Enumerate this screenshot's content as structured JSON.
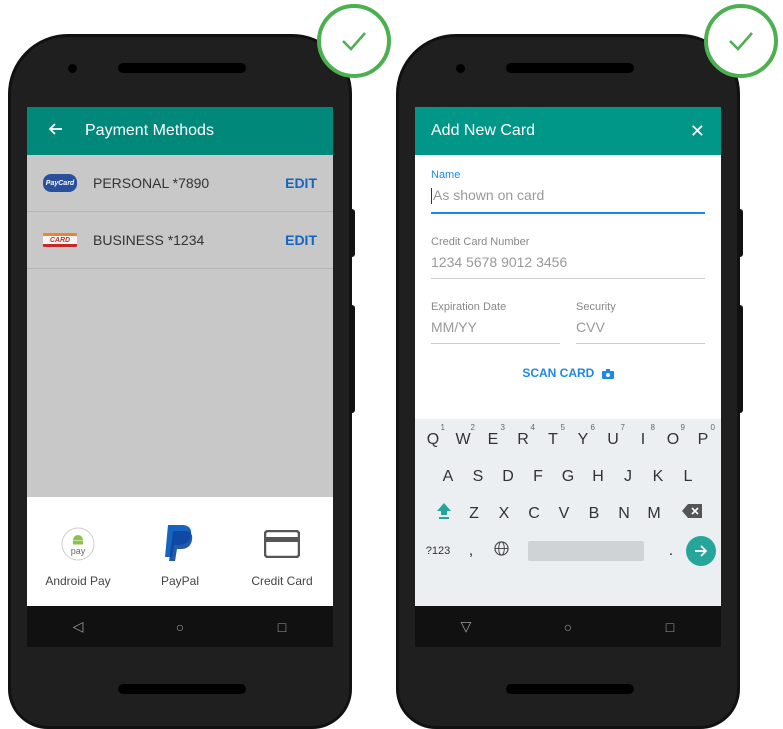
{
  "left_screen": {
    "app_bar": {
      "back_icon": "arrow-left-icon",
      "title": "Payment Methods"
    },
    "cards": [
      {
        "logo": "PayCard",
        "name": "PERSONAL *7890",
        "action": "EDIT"
      },
      {
        "logo": "CARD",
        "name": "BUSINESS *1234",
        "action": "EDIT"
      }
    ],
    "payment_options": [
      {
        "icon": "android-pay-icon",
        "icon_text": "pay",
        "label": "Android Pay"
      },
      {
        "icon": "paypal-icon",
        "label": "PayPal"
      },
      {
        "icon": "credit-card-icon",
        "label": "Credit Card"
      }
    ],
    "nav": {
      "back": "◁",
      "home": "○",
      "recents": "□"
    }
  },
  "right_screen": {
    "app_bar": {
      "title": "Add New Card",
      "close": "✕"
    },
    "form": {
      "name_label": "Name",
      "name_placeholder": "As shown on card",
      "number_label": "Credit Card Number",
      "number_placeholder": "1234 5678 9012 3456",
      "expiry_label": "Expiration Date",
      "expiry_placeholder": "MM/YY",
      "security_label": "Security",
      "security_placeholder": "CVV",
      "scan_label": "SCAN CARD"
    },
    "keyboard": {
      "row1": [
        "Q",
        "W",
        "E",
        "R",
        "T",
        "Y",
        "U",
        "I",
        "O",
        "P"
      ],
      "row1_hints": [
        "1",
        "2",
        "3",
        "4",
        "5",
        "6",
        "7",
        "8",
        "9",
        "0"
      ],
      "row2": [
        "A",
        "S",
        "D",
        "F",
        "G",
        "H",
        "J",
        "K",
        "L"
      ],
      "row3": [
        "Z",
        "X",
        "C",
        "V",
        "B",
        "N",
        "M"
      ],
      "symbols_key": "?123",
      "comma": ",",
      "period": "."
    },
    "nav": {
      "back": "▽",
      "home": "○",
      "recents": "□"
    }
  },
  "colors": {
    "teal_bar": "#00897b",
    "teal_bar_2": "#009688",
    "accent_blue": "#1e88e5",
    "check_green": "#4caf50"
  }
}
